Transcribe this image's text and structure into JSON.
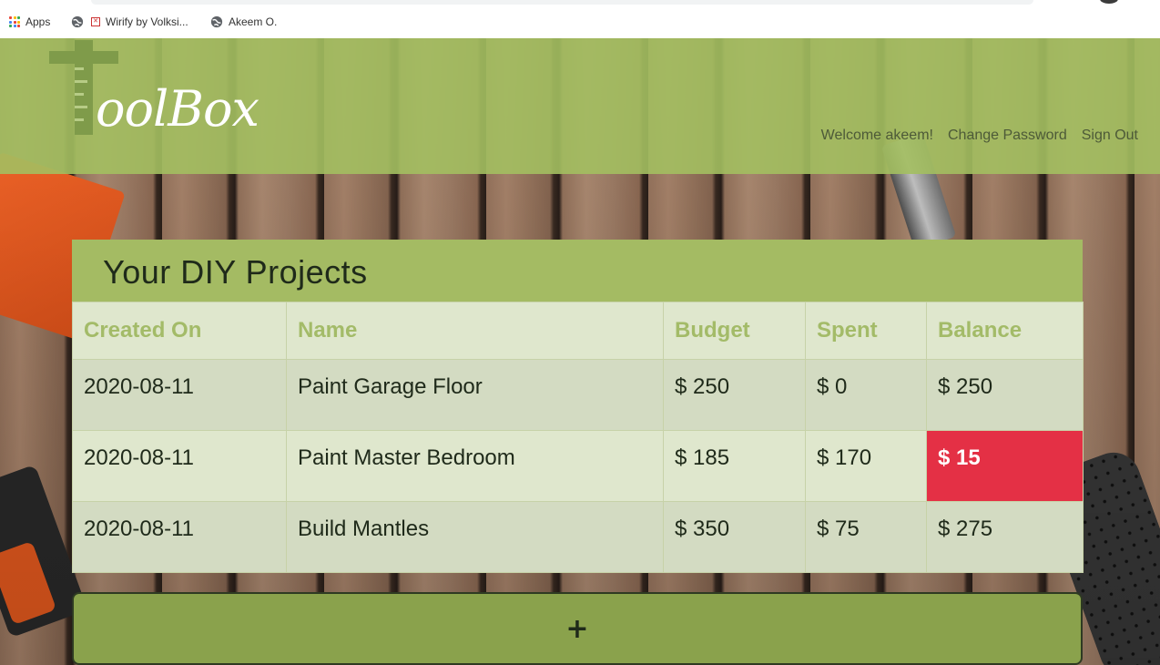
{
  "browser": {
    "bookmarks": [
      {
        "label": "Apps",
        "icon": "apps-grid-icon"
      },
      {
        "label": "Wirify by Volksi...",
        "icon": "globe-icon"
      },
      {
        "label": "Akeem O.",
        "icon": "globe-icon"
      }
    ]
  },
  "header": {
    "logo_text": "oolBox",
    "nav": {
      "welcome": "Welcome akeem!",
      "change_password": "Change Password",
      "sign_out": "Sign Out"
    }
  },
  "projects": {
    "title": "Your DIY Projects",
    "columns": [
      "Created On",
      "Name",
      "Budget",
      "Spent",
      "Balance"
    ],
    "rows": [
      {
        "created_on": "2020-08-11",
        "name": "Paint Garage Floor",
        "budget": "$ 250",
        "spent": "$ 0",
        "balance": "$ 250",
        "negative": false
      },
      {
        "created_on": "2020-08-11",
        "name": "Paint Master Bedroom",
        "budget": "$ 185",
        "spent": "$ 170",
        "balance": "$ 15",
        "negative": true
      },
      {
        "created_on": "2020-08-11",
        "name": "Build Mantles",
        "budget": "$ 350",
        "spent": "$ 75",
        "balance": "$ 275",
        "negative": false
      }
    ],
    "add_label": "+"
  },
  "colors": {
    "header_green": "#a3bf60",
    "title_green": "#a4bb63",
    "header_text_green": "#a3bb68",
    "alert_red": "#e43045",
    "add_button_green": "#8aa24c"
  }
}
